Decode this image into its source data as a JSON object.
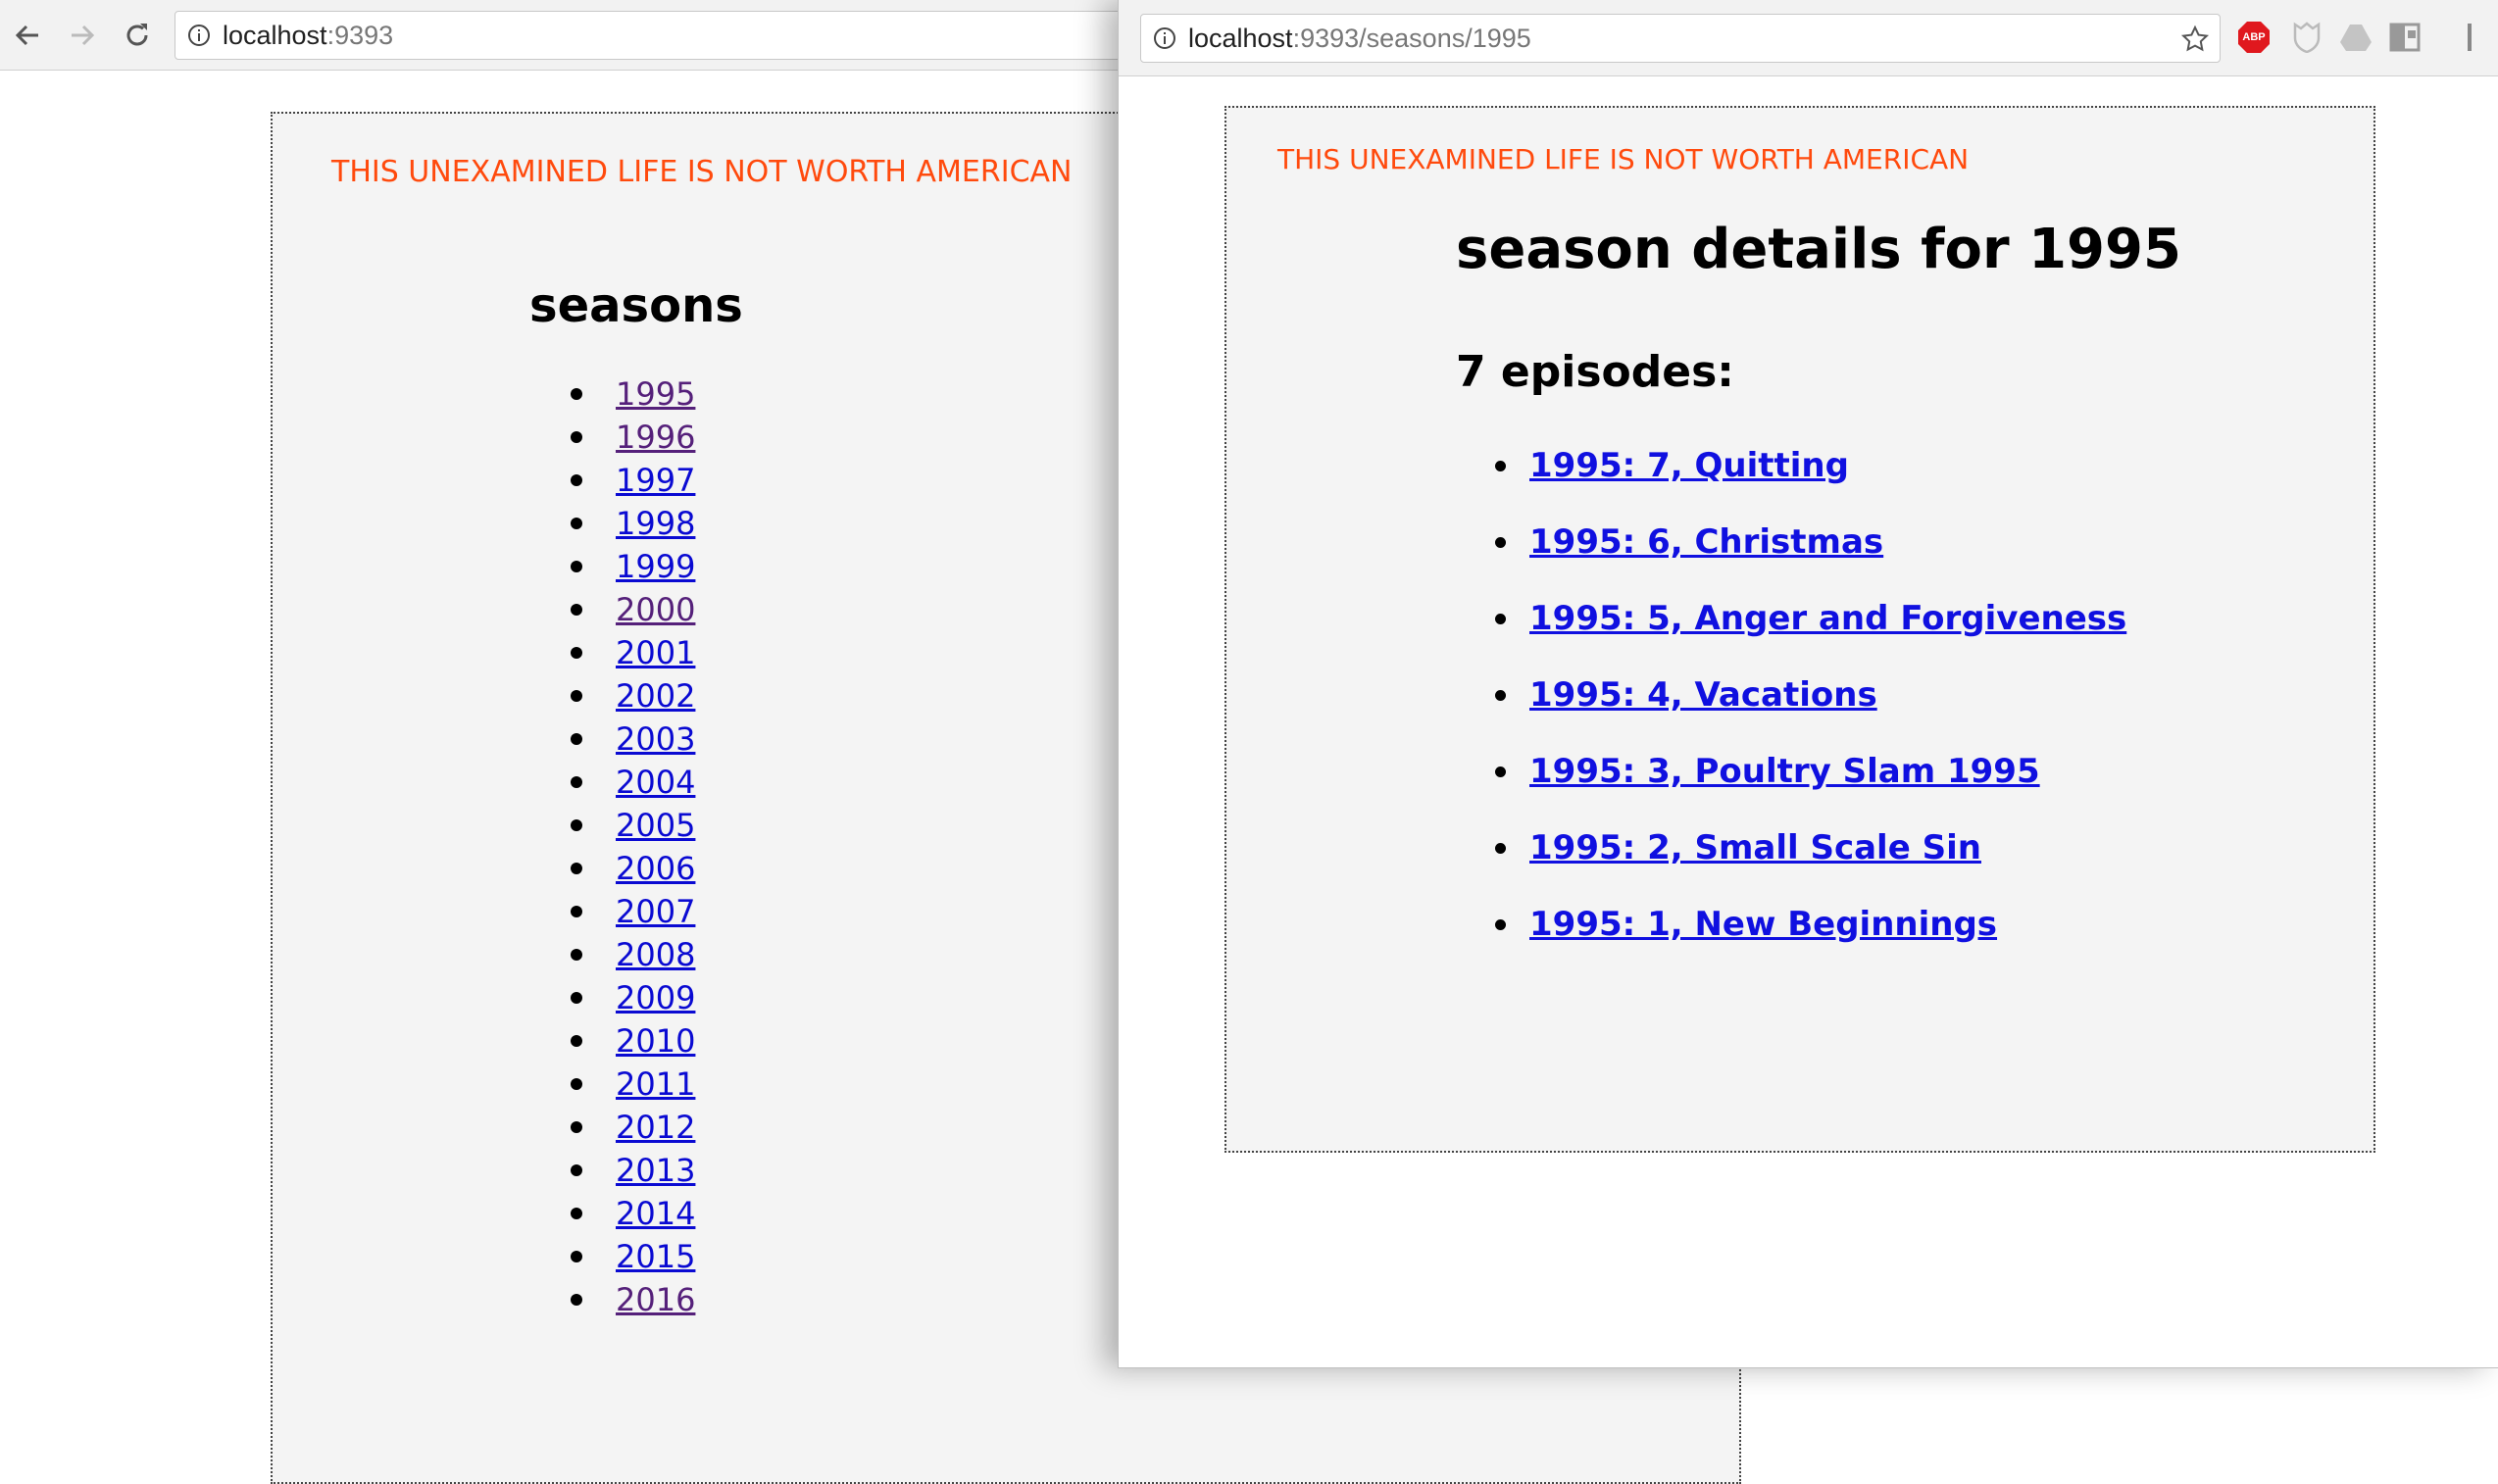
{
  "back_window": {
    "url_host": "localhost",
    "url_rest": ":9393",
    "page": {
      "motto": "THIS UNEXAMINED LIFE IS NOT WORTH AMERICAN",
      "title": "seasons",
      "seasons": [
        "1995",
        "1996",
        "1997",
        "1998",
        "1999",
        "2000",
        "2001",
        "2002",
        "2003",
        "2004",
        "2005",
        "2006",
        "2007",
        "2008",
        "2009",
        "2010",
        "2011",
        "2012",
        "2013",
        "2014",
        "2015",
        "2016"
      ],
      "visited_seasons": [
        "1995",
        "1996",
        "2000",
        "2016"
      ]
    }
  },
  "front_window": {
    "url_host": "localhost",
    "url_rest": ":9393/seasons/1995",
    "extensions": [
      "star-icon",
      "adblock-icon",
      "shield-extension-icon",
      "drive-icon",
      "layout-extension-icon"
    ],
    "adblock_label": "ABP",
    "page": {
      "motto": "THIS UNEXAMINED LIFE IS NOT WORTH AMERICAN",
      "title": "season details for 1995",
      "episode_count": "7 episodes:",
      "episodes": [
        "1995: 7, Quitting",
        "1995: 6, Christmas",
        "1995: 5, Anger and Forgiveness",
        "1995: 4, Vacations",
        "1995: 3, Poultry Slam 1995",
        "1995: 2, Small Scale Sin",
        "1995: 1, New Beginnings"
      ]
    }
  },
  "colors": {
    "motto": "#ff4a0d",
    "link": "#0a0ad2",
    "visited_link": "#55207a",
    "page_background": "#f4f4f4"
  }
}
